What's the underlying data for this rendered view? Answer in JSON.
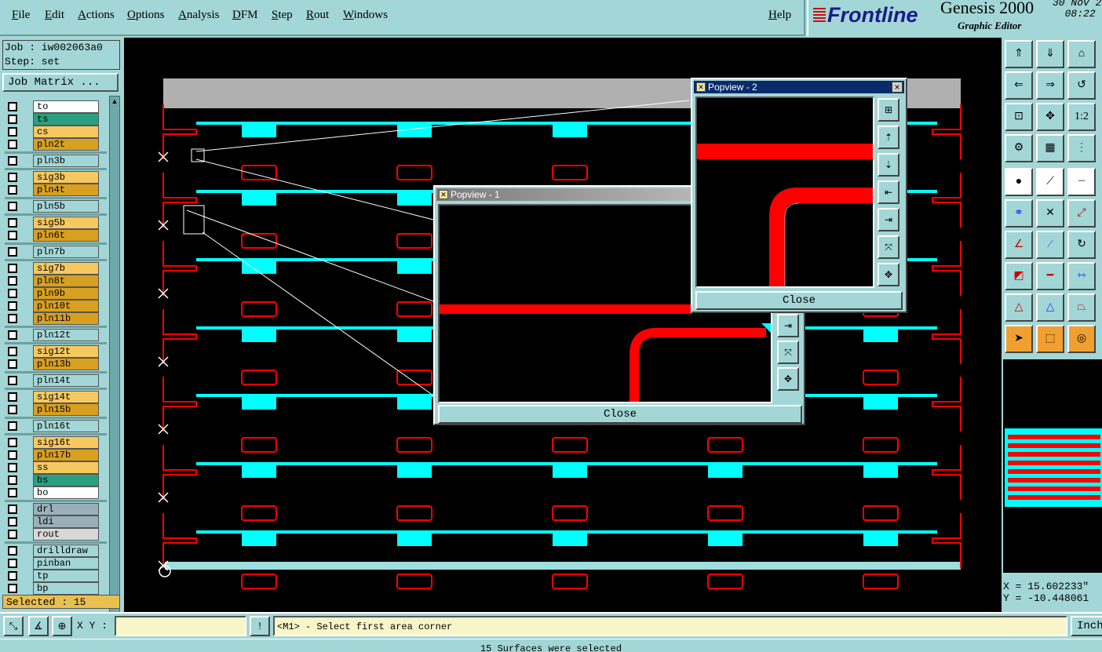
{
  "menu": {
    "file": "File",
    "edit": "Edit",
    "actions": "Actions",
    "options": "Options",
    "analysis": "Analysis",
    "dfm": "DFM",
    "step": "Step",
    "rout": "Rout",
    "windows": "Windows",
    "help": "Help"
  },
  "brand": {
    "logo": "Frontline",
    "product": "Genesis 2000",
    "subtitle": "Graphic Editor",
    "date": "30 Nov 2",
    "time": "08:22 "
  },
  "job": {
    "job_line": "Job : iw002063a0",
    "step_line": "Step: set",
    "matrix_button": "Job Matrix ..."
  },
  "layers": [
    {
      "name": "to",
      "color": "#ffffff"
    },
    {
      "name": "ts",
      "color": "#2aa080"
    },
    {
      "name": "cs",
      "color": "#f6c860"
    },
    {
      "name": "pln2t",
      "color": "#d8a020"
    },
    {
      "name": "pln3b",
      "color": "#a3d6d6"
    },
    {
      "name": "sig3b",
      "color": "#f6c860"
    },
    {
      "name": "pln4t",
      "color": "#d8a020"
    },
    {
      "name": "pln5b",
      "color": "#a3d6d6"
    },
    {
      "name": "sig5b",
      "color": "#f6c860"
    },
    {
      "name": "pln6t",
      "color": "#d8a020"
    },
    {
      "name": "pln7b",
      "color": "#a3d6d6"
    },
    {
      "name": "sig7b",
      "color": "#f6c860"
    },
    {
      "name": "pln8t",
      "color": "#d8a020"
    },
    {
      "name": "pln9b",
      "color": "#d8a020"
    },
    {
      "name": "pln10t",
      "color": "#d8a020"
    },
    {
      "name": "pln11b",
      "color": "#d8a020"
    },
    {
      "name": "pln12t",
      "color": "#a3d6d6"
    },
    {
      "name": "sig12t",
      "color": "#f6c860"
    },
    {
      "name": "pln13b",
      "color": "#d8a020"
    },
    {
      "name": "pln14t",
      "color": "#a3d6d6"
    },
    {
      "name": "sig14t",
      "color": "#f6c860"
    },
    {
      "name": "pln15b",
      "color": "#d8a020"
    },
    {
      "name": "pln16t",
      "color": "#a3d6d6"
    },
    {
      "name": "sig16t",
      "color": "#f6c860"
    },
    {
      "name": "pln17b",
      "color": "#d8a020"
    },
    {
      "name": "ss",
      "color": "#f6c860"
    },
    {
      "name": "bs",
      "color": "#2aa080"
    },
    {
      "name": "bo",
      "color": "#ffffff"
    },
    {
      "name": "drl",
      "color": "#9ab0b8"
    },
    {
      "name": "ldi",
      "color": "#9ab0b8"
    },
    {
      "name": "rout",
      "color": "#d8d8d8"
    },
    {
      "name": "drilldraw",
      "color": "#a3d6d6"
    },
    {
      "name": "pinban",
      "color": "#a3d6d6"
    },
    {
      "name": "tp",
      "color": "#a3d6d6"
    },
    {
      "name": "bp",
      "color": "#a3d6d6"
    }
  ],
  "selected_count": "Selected : 15",
  "popview1": {
    "title": "Popview - 1",
    "close": "Close"
  },
  "popview2": {
    "title": "Popview - 2",
    "close": "Close"
  },
  "coords": {
    "x": "X = 15.602233\"",
    "y": "Y = -10.448061"
  },
  "status": {
    "xy_label": "X Y :",
    "xy_value": "",
    "prompt": "<M1> - Select first area corner",
    "units": "Inch",
    "message": "15 Surfaces were selected"
  },
  "colors": {
    "copper": "#ff0000",
    "pad": "#00ffff",
    "bg": "#000000",
    "panel": "#a3d6d6"
  }
}
